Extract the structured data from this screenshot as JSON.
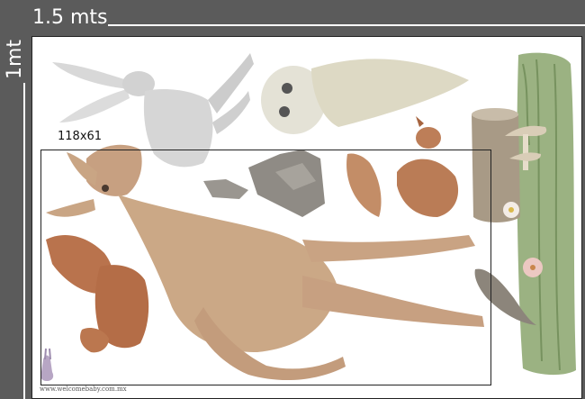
{
  "dimensions": {
    "width_label": "1.5 mts",
    "height_label": "1mt",
    "inner_label": "118x61"
  },
  "footer": {
    "website": "www.welcomebaby.com.mx"
  },
  "illustrations": [
    "rabbit-icon",
    "owl-icon",
    "rocks-icon",
    "squirrel-icon",
    "deer-icon",
    "fox-icon",
    "grass-panel-icon",
    "mushrooms-icon",
    "flower-icon",
    "bird-icon",
    "logo-rabbit-icon"
  ],
  "colors": {
    "background": "#5b5b5b",
    "sheet": "#ffffff",
    "deer": "#c9a585",
    "fox": "#b9734d",
    "grass": "#8aa56c",
    "gray_animals": "#cfcfcf"
  }
}
